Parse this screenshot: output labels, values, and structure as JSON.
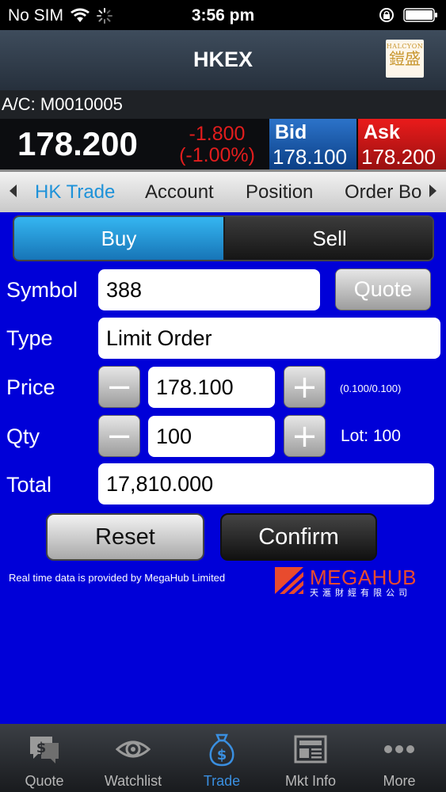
{
  "status_bar": {
    "carrier": "No SIM",
    "time": "3:56 pm",
    "icons": [
      "wifi-icon",
      "activity-spinner-icon",
      "orientation-lock-icon",
      "battery-icon"
    ]
  },
  "nav": {
    "title": "HKEX",
    "logo_small": "HALCYON",
    "logo_big": "鎧盛"
  },
  "account": {
    "label": "A/C: M0010005"
  },
  "quote": {
    "price": "178.200",
    "change": "-1.800",
    "change_pct": "(-1.00%)",
    "bid_label": "Bid",
    "bid_value": "178.100",
    "ask_label": "Ask",
    "ask_value": "178.200",
    "colors": {
      "down": "#e21d1d",
      "bid": "#2c73c9",
      "ask": "#ea1b1b"
    }
  },
  "tabs": {
    "items": [
      "HK Trade",
      "Account",
      "Position",
      "Order Book"
    ],
    "visible_last": "Order Bo",
    "active": "HK Trade",
    "active_color": "#1e92d9"
  },
  "side": {
    "buy": "Buy",
    "sell": "Sell",
    "selected": "Buy"
  },
  "form": {
    "symbol_label": "Symbol",
    "symbol_value": "388",
    "quote_button": "Quote",
    "type_label": "Type",
    "type_value": "Limit Order",
    "price_label": "Price",
    "price_value": "178.100",
    "price_spread": "(0.100/0.100)",
    "qty_label": "Qty",
    "qty_value": "100",
    "lot": "Lot: 100",
    "total_label": "Total",
    "total_value": "17,810.000",
    "minus": "−",
    "plus": "+"
  },
  "actions": {
    "reset": "Reset",
    "confirm": "Confirm"
  },
  "footer": {
    "credit": "Real time data is provided by MegaHub Limited",
    "brand": "MEGAHUB",
    "brand_cn": "天滙財經有限公司",
    "brand_color": "#e84b2e"
  },
  "tabbar": {
    "items": [
      {
        "label": "Quote",
        "icon": "quote-bubble-icon"
      },
      {
        "label": "Watchlist",
        "icon": "eye-icon"
      },
      {
        "label": "Trade",
        "icon": "money-bag-icon"
      },
      {
        "label": "Mkt Info",
        "icon": "newspaper-icon"
      },
      {
        "label": "More",
        "icon": "more-dots-icon"
      }
    ],
    "active": "Trade",
    "active_color": "#3a8fe0"
  },
  "page_background": "#0000d8"
}
